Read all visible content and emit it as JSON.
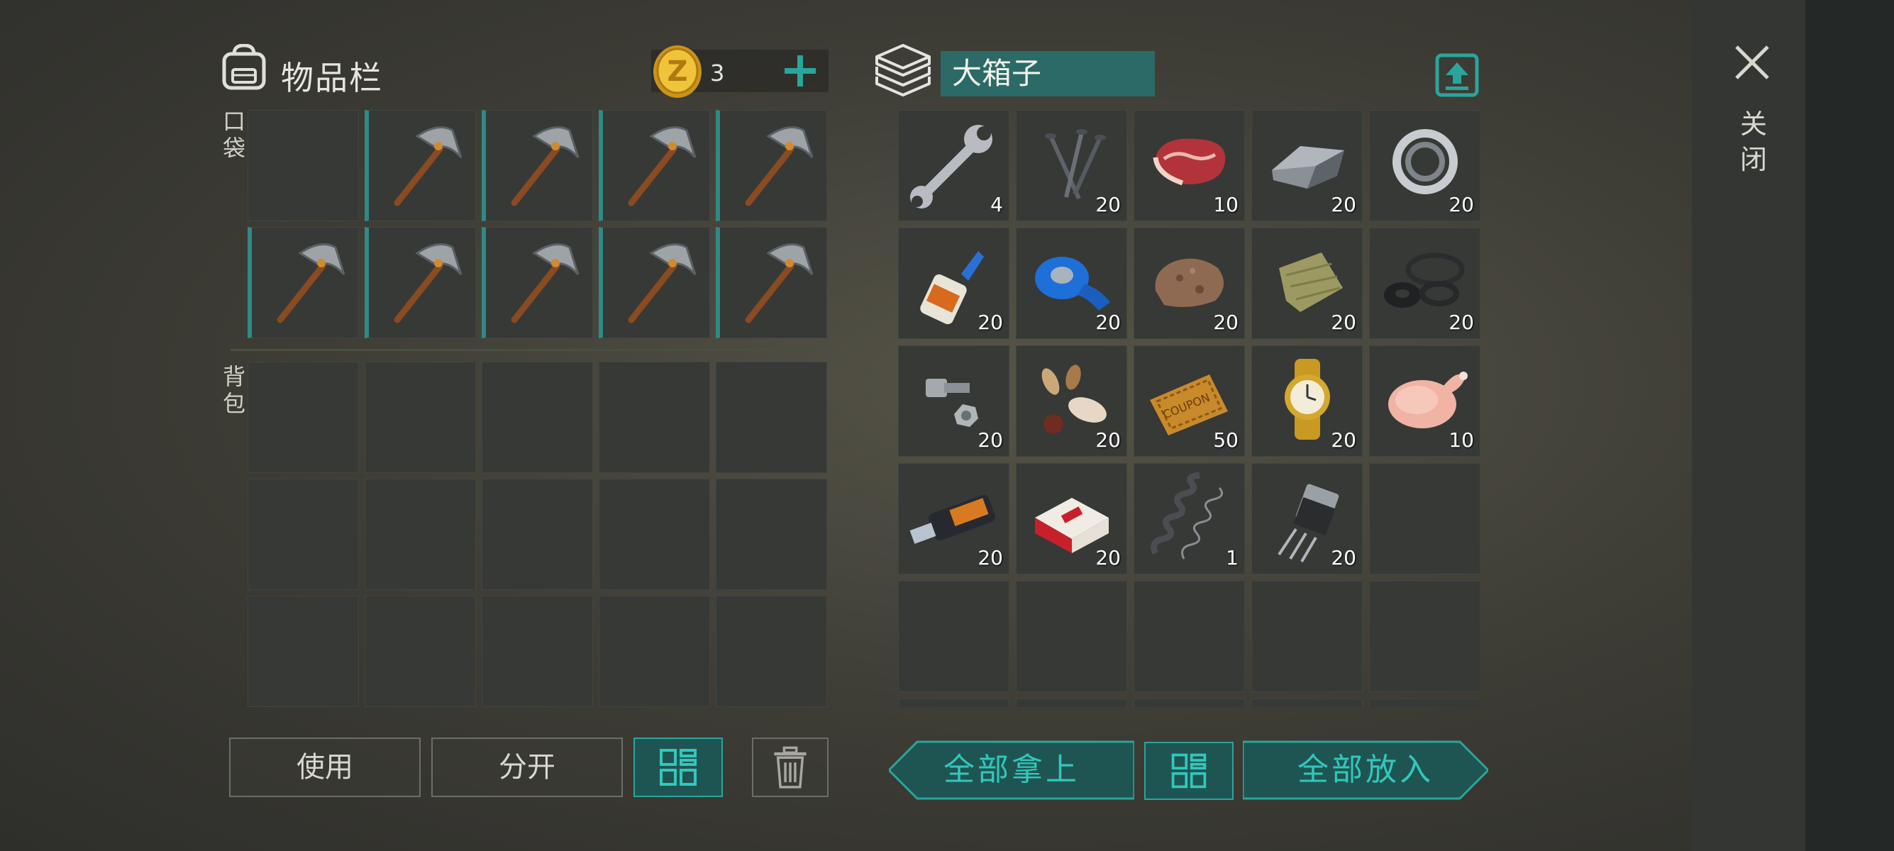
{
  "inventory": {
    "title": "物品栏",
    "coins": "3",
    "pocket_label": "口袋",
    "backpack_label": "背包",
    "pocket_slots": [
      {
        "item": "empty",
        "equip": false
      },
      {
        "item": "pickaxe",
        "equip": true
      },
      {
        "item": "pickaxe",
        "equip": true
      },
      {
        "item": "pickaxe",
        "equip": true
      },
      {
        "item": "pickaxe",
        "equip": true
      },
      {
        "item": "pickaxe",
        "equip": true
      },
      {
        "item": "pickaxe",
        "equip": true
      },
      {
        "item": "pickaxe",
        "equip": true
      },
      {
        "item": "pickaxe",
        "equip": true
      },
      {
        "item": "pickaxe",
        "equip": true
      }
    ],
    "backpack_slot_count": 15
  },
  "container": {
    "name": "大箱子",
    "close_label": "关闭",
    "items": [
      {
        "icon": "wrench-icon",
        "qty": "4"
      },
      {
        "icon": "nails-icon",
        "qty": "20"
      },
      {
        "icon": "raw-meat-icon",
        "qty": "10"
      },
      {
        "icon": "iron-ingot-icon",
        "qty": "20"
      },
      {
        "icon": "bearing-icon",
        "qty": "20"
      },
      {
        "icon": "glue-icon",
        "qty": "20"
      },
      {
        "icon": "tape-icon",
        "qty": "20"
      },
      {
        "icon": "stone-icon",
        "qty": "20"
      },
      {
        "icon": "cloth-icon",
        "qty": "20"
      },
      {
        "icon": "rubber-rings-icon",
        "qty": "20"
      },
      {
        "icon": "bolt-nut-icon",
        "qty": "20"
      },
      {
        "icon": "seeds-icon",
        "qty": "20"
      },
      {
        "icon": "coupon-icon",
        "qty": "50"
      },
      {
        "icon": "gold-watch-icon",
        "qty": "20"
      },
      {
        "icon": "raw-chicken-icon",
        "qty": "10"
      },
      {
        "icon": "usb-drive-icon",
        "qty": "20"
      },
      {
        "icon": "cigarettes-icon",
        "qty": "20"
      },
      {
        "icon": "spring-icon",
        "qty": "1"
      },
      {
        "icon": "transistor-icon",
        "qty": "20"
      }
    ],
    "slot_count": 30
  },
  "buttons": {
    "use": "使用",
    "split": "分开",
    "take_all": "全部拿上",
    "put_all": "全部放入"
  },
  "colors": {
    "accent": "#2aa59c",
    "equip_bar": "#2f8a84",
    "crate_name_bg": "#2b6a66"
  }
}
